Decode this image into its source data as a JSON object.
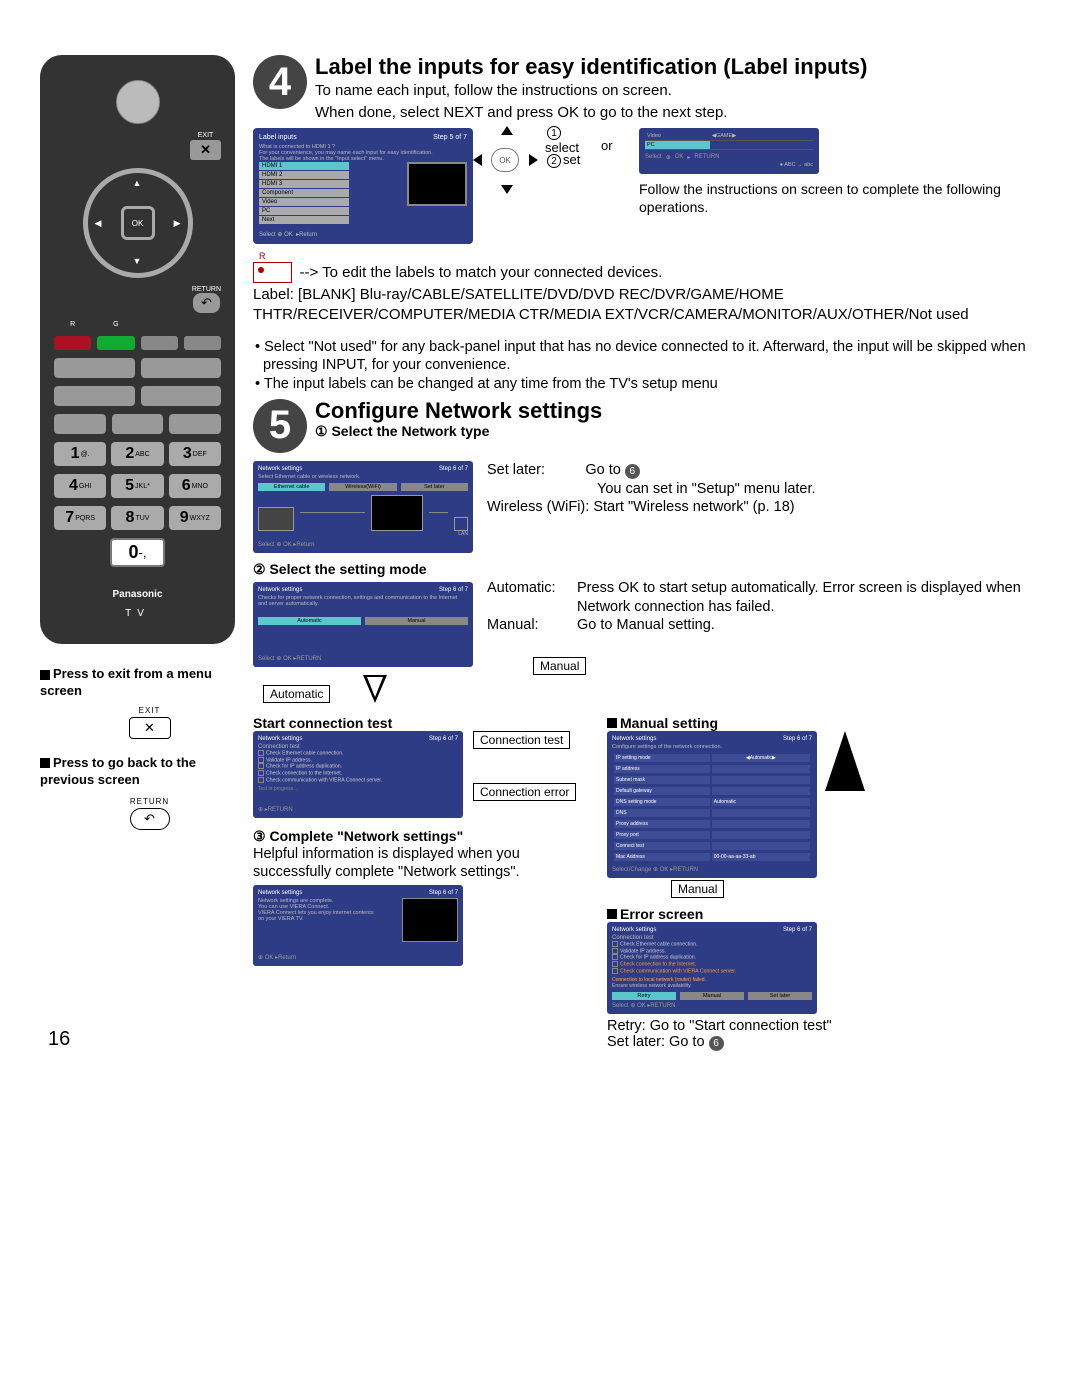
{
  "page_number": "16",
  "remote": {
    "exit": "EXIT",
    "ok": "OK",
    "return": "RETURN",
    "r": "R",
    "g": "G",
    "keys": {
      "k1": {
        "n": "1",
        "s": "@."
      },
      "k2": {
        "n": "2",
        "s": "ABC"
      },
      "k3": {
        "n": "3",
        "s": "DEF"
      },
      "k4": {
        "n": "4",
        "s": "GHI"
      },
      "k5": {
        "n": "5",
        "s": "JKL*"
      },
      "k6": {
        "n": "6",
        "s": "MNO"
      },
      "k7": {
        "n": "7",
        "s": "PQRS"
      },
      "k8": {
        "n": "8",
        "s": "TUV"
      },
      "k9": {
        "n": "9",
        "s": "WXYZ"
      },
      "k0": {
        "n": "0",
        "s": "-,"
      }
    },
    "brand": "Panasonic",
    "tv": "TV"
  },
  "left_notes": {
    "exit_title": "Press to exit from a menu screen",
    "exit_label": "EXIT",
    "return_title": "Press to go back to the previous screen",
    "return_label": "RETURN"
  },
  "step4": {
    "badge": "4",
    "title": "Label the inputs for easy identification (Label inputs)",
    "line1": "To name each input, follow the instructions on screen.",
    "line2": "When done, select NEXT and press OK to go to the next step.",
    "nav_select": "select",
    "nav_or": "or",
    "nav_set": "set",
    "follow_text": "Follow the instructions on screen to complete the following operations.",
    "edit_text": "--> To edit the labels to match your connected devices.",
    "label_list": "Label: [BLANK] Blu-ray/CABLE/SATELLITE/DVD/DVD REC/DVR/GAME/HOME THTR/RECEIVER/COMPUTER/MEDIA CTR/MEDIA EXT/VCR/CAMERA/MONITOR/AUX/OTHER/Not used",
    "bullets": [
      "Select \"Not used\" for any back-panel input that has no device connected to it. Afterward, the input will be skipped when pressing INPUT, for your convenience.",
      "The input labels can be changed at any time from the TV's setup menu"
    ],
    "tv_label_inputs": {
      "title": "Label inputs",
      "step": "Step 5 of 7",
      "desc": "What is connected to HDMI 1 ?\nFor your convenience, you may name each input for easy identification.\nThe labels will be shown in the \"Input select\" menu.",
      "rows": [
        "HDMI 1",
        "HDMI 2",
        "HDMI 3",
        "Component",
        "Video",
        "PC",
        "Next"
      ],
      "footer_select": "Select",
      "footer_ok": "OK",
      "footer_return": "Return"
    },
    "small_panel": {
      "rows": [
        {
          "l": "Video",
          "r": "GAME"
        },
        {
          "l": "PC",
          "r": ""
        }
      ],
      "select": "Select",
      "ok": "OK",
      "return": "RETURN",
      "abc": "ABC → abc"
    },
    "r_label": "R"
  },
  "step5": {
    "badge": "5",
    "title": "Configure Network settings",
    "sub1_num": "①",
    "sub1": "Select the Network type",
    "set_later_lbl": "Set later:",
    "goto6": "Go to ",
    "six": "6",
    "set_later_desc": "You can set in \"Setup\" menu later.",
    "wifi_lbl": "Wireless (WiFi):",
    "wifi_desc": "Start \"Wireless network\" (p. 18)",
    "tv_net1": {
      "title": "Network settings",
      "step": "Step 6 of 7",
      "desc": "Select Ethernet cable or wireless network.",
      "opts": [
        "Ethernet cable",
        "Wireless(WiFi)",
        "Set later"
      ],
      "select": "Select",
      "ok": "OK",
      "return": "Return",
      "lan": "LAN"
    },
    "sub2_num": "②",
    "sub2": "Select the setting mode",
    "auto_lbl": "Automatic:",
    "auto_desc": "Press OK to start setup automatically. Error screen is displayed when Network connection has failed.",
    "manual_lbl": "Manual:",
    "manual_desc": "Go to Manual setting.",
    "tv_net2": {
      "title": "Network settings",
      "step": "Step 6 of 7",
      "desc": "Checks for proper network connection, settings and communication to the Internet and server automatically.",
      "opts": [
        "Automatic",
        "Manual"
      ],
      "select": "Select",
      "ok": "OK",
      "return": "RETURN"
    },
    "automatic_tag": "Automatic",
    "manual_tag": "Manual",
    "start_conn": "Start connection test",
    "conn_test_tag": "Connection test",
    "conn_error_tag": "Connection error",
    "tv_conn": {
      "title": "Network settings",
      "step": "Step 6 of 7",
      "subtitle": "Connection test",
      "lines": [
        "Check Ethernet cable connection.",
        "Validate IP address.",
        "Check for IP address duplication.",
        "Check connection to the Internet.",
        "Check communication with VIERA Connect server."
      ],
      "progress": "Test in progress...",
      "return": "RETURN"
    },
    "sub3_num": "③",
    "sub3": "Complete \"Network settings\"",
    "sub3_desc": "Helpful information is displayed when you successfully complete \"Network settings\".",
    "tv_done": {
      "title": "Network settings",
      "step": "Step 6 of 7",
      "body": "Network settings are complete.\nYou can use VIERA Connect.\nVIERA Connect lets you enjoy internet contents on your VIERA TV.",
      "ok": "OK",
      "return": "Return"
    },
    "manual_setting_h": "Manual setting",
    "tv_manual": {
      "title": "Network settings",
      "step": "Step 6 of 7",
      "desc": "Configure settings of the network connection.",
      "rows": [
        {
          "l": "IP setting mode",
          "r": "Automatic"
        },
        {
          "l": "IP address",
          "r": ""
        },
        {
          "l": "Subnet mask",
          "r": ""
        },
        {
          "l": "Default gateway",
          "r": ""
        },
        {
          "l": "DNS setting mode",
          "r": "Automatic"
        },
        {
          "l": "DNS",
          "r": ""
        },
        {
          "l": "Proxy address",
          "r": ""
        },
        {
          "l": "Proxy port",
          "r": ""
        },
        {
          "l": "Connect test",
          "r": ""
        },
        {
          "l": "Mac Address",
          "r": "00-00-aa-aa-33-ab"
        }
      ],
      "select": "Select",
      "change": "Change",
      "ok": "OK",
      "return": "RETURN"
    },
    "manual_tag2": "Manual",
    "error_screen_h": "Error screen",
    "tv_error": {
      "title": "Network settings",
      "step": "Step 6 of 7",
      "subtitle": "Connection test",
      "lines": [
        "Check Ethernet cable connection.",
        "Validate IP address.",
        "Check for IP address duplication.",
        "Check connection to the Internet.",
        "Check communication with VIERA Connect server."
      ],
      "err1": "Connection to local network (router) failed.",
      "err2": "Ensure wireless network availability.",
      "opts": [
        "Retry",
        "Manual",
        "Set later"
      ],
      "select": "Select",
      "ok": "OK",
      "return": "RETURN"
    },
    "retry_line": "Retry: Go to \"Start connection test\"",
    "setlater_line": "Set later: Go to "
  }
}
